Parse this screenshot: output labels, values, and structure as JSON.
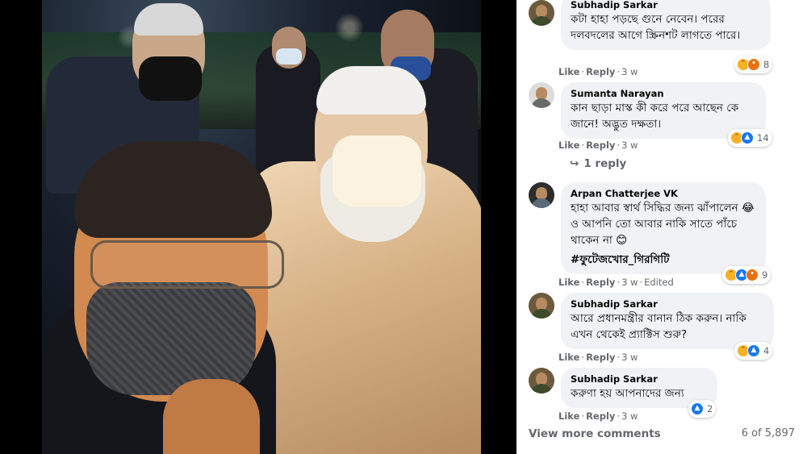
{
  "comments": [
    {
      "name": "Subhadip Sarkar",
      "text": "কটা হাহা পড়ছে গুনে নেবেন। পরের দলবদলের আগে স্ক্রিনশট লাগতে পারে।",
      "actions": {
        "like": "Like",
        "reply": "Reply",
        "time": "3 w"
      },
      "reactions": {
        "icons": [
          "haha-icon",
          "angry-icon"
        ],
        "count": "8"
      }
    },
    {
      "name": "Sumanta Narayan",
      "text": "কান ছাড়া মাস্ক কী করে পরে আছেন কে জানে! অদ্ভুত দক্ষতা।",
      "actions": {
        "like": "Like",
        "reply": "Reply",
        "time": "3 w"
      },
      "reactions": {
        "icons": [
          "haha-icon",
          "like-icon"
        ],
        "count": "14"
      },
      "replies_link": "1 reply"
    },
    {
      "name": "Arpan Chatterjee VK",
      "text": "হাহা আবার স্বার্থ সিদ্ধির জন্য ঝাঁপালেন 😂 ও আপনি তো আবার নাকি সাতে পাঁচে থাকেন না 😊",
      "hashtag": "#ফুটেজখোর_গিরগিটি",
      "actions": {
        "like": "Like",
        "reply": "Reply",
        "time": "3 w",
        "edited": "Edited"
      },
      "reactions": {
        "icons": [
          "haha-icon",
          "like-icon",
          "angry-icon"
        ],
        "count": "9"
      }
    },
    {
      "name": "Subhadip Sarkar",
      "text": "আরে প্রধানমন্ত্রীর বানান ঠিক করুন। নাকি এখন থেকেই প্র্যাক্টিস শুরু?",
      "actions": {
        "like": "Like",
        "reply": "Reply",
        "time": "3 w"
      },
      "reactions": {
        "icons": [
          "haha-icon",
          "like-icon"
        ],
        "count": "4"
      }
    },
    {
      "name": "Subhadip Sarkar",
      "text": "করুণা হয় আপনাদের জন্য",
      "actions": {
        "like": "Like",
        "reply": "Reply",
        "time": "3 w"
      },
      "reactions": {
        "icons": [
          "like-icon"
        ],
        "count": "2"
      }
    }
  ],
  "footer": {
    "view_more": "View more comments",
    "count": "6 of 5,897"
  },
  "colors": {
    "bubble_bg": "#f0f2f5",
    "meta_text": "#65676b",
    "like_blue": "#1877f2",
    "haha_yellow": "#f7b125"
  }
}
